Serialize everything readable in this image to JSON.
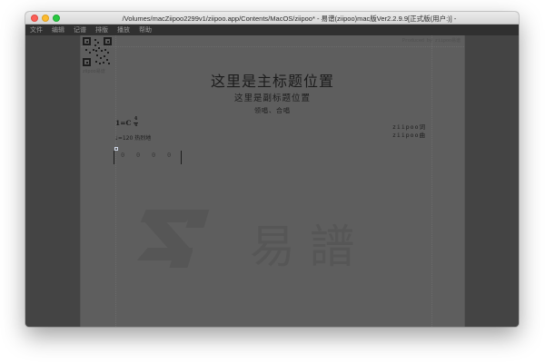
{
  "window": {
    "title": "/Volumes/macZiipoo2299v1/ziipoo.app/Contents/MacOS/ziipoo* - 易谱(ziipoo)mac版Ver2.2.9.9[正式版(用户:)] -"
  },
  "menu": {
    "items": [
      "文件",
      "编辑",
      "记谱",
      "排版",
      "播放",
      "帮助"
    ]
  },
  "score": {
    "header_right": "Produced by ziipoo易谱",
    "main_title": "这里是主标题位置",
    "sub_title": "这里是副标题位置",
    "performance": "领唱、合唱",
    "key_signature": "1=C",
    "time_numerator": "4",
    "time_denominator": "4",
    "tempo": "♩=120 热烈地",
    "credits": [
      "ziipoo词",
      "ziipoo曲"
    ],
    "measure_notes": [
      "0",
      "0",
      "0",
      "0"
    ],
    "qr_caption": "ziipoo易谱"
  },
  "watermark": {
    "text": "易 譜",
    "color": "#555555"
  },
  "colors": {
    "paper": "#5e5e5e",
    "desk": "#444444",
    "menubar": "#303030",
    "close": "#fc5f57",
    "minimize": "#fdbb2e",
    "maximize": "#28c840"
  }
}
